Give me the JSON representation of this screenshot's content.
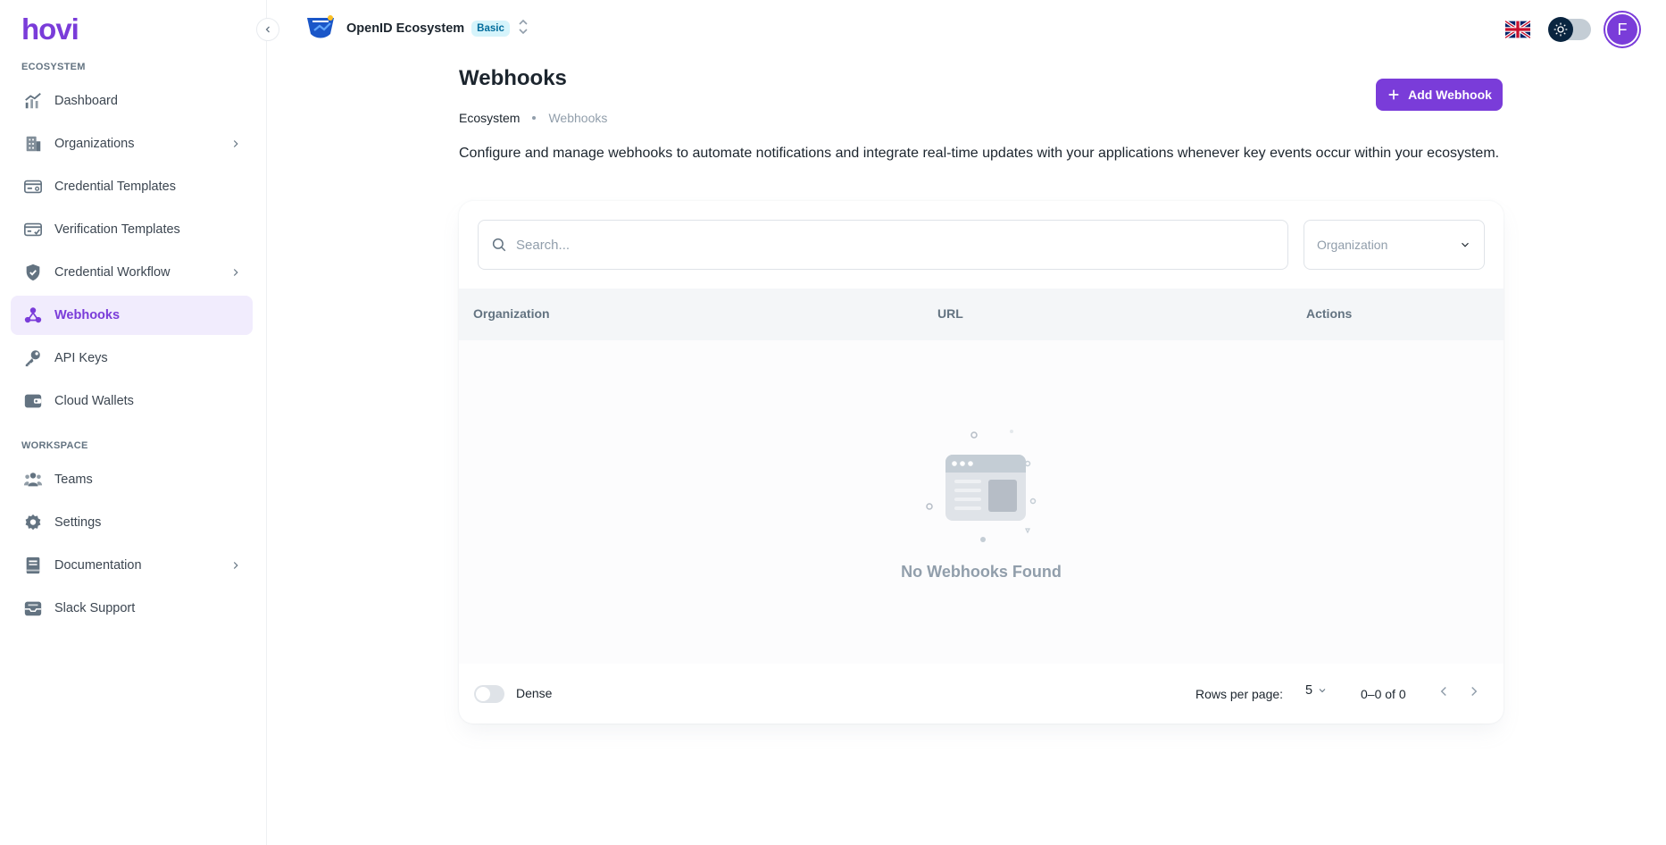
{
  "sidebar": {
    "logo": "hovi",
    "sections": [
      {
        "label": "ECOSYSTEM"
      },
      {
        "label": "WORKSPACE"
      }
    ],
    "items": [
      {
        "label": "Dashboard",
        "icon": "chart-icon"
      },
      {
        "label": "Organizations",
        "icon": "building-icon",
        "expandable": true
      },
      {
        "label": "Credential Templates",
        "icon": "card-icon"
      },
      {
        "label": "Verification Templates",
        "icon": "verify-card-icon"
      },
      {
        "label": "Credential Workflow",
        "icon": "shield-icon",
        "expandable": true
      },
      {
        "label": "Webhooks",
        "icon": "webhook-icon",
        "active": true
      },
      {
        "label": "API Keys",
        "icon": "key-icon"
      },
      {
        "label": "Cloud Wallets",
        "icon": "wallet-icon"
      },
      {
        "label": "Teams",
        "icon": "people-icon"
      },
      {
        "label": "Settings",
        "icon": "gear-icon"
      },
      {
        "label": "Documentation",
        "icon": "book-icon",
        "expandable": true
      },
      {
        "label": "Slack Support",
        "icon": "inbox-icon"
      }
    ]
  },
  "topbar": {
    "ecosystem_name": "OpenID Ecosystem",
    "plan_badge": "Basic",
    "avatar_initial": "F"
  },
  "page": {
    "title": "Webhooks",
    "breadcrumb": {
      "root": "Ecosystem",
      "current": "Webhooks"
    },
    "add_button": "Add Webhook",
    "description": "Configure and manage webhooks to automate notifications and integrate real-time updates with your applications whenever key events occur within your ecosystem."
  },
  "table": {
    "search_placeholder": "Search...",
    "org_filter_label": "Organization",
    "columns": [
      "Organization",
      "URL",
      "Actions"
    ],
    "empty_text": "No Webhooks Found",
    "dense_label": "Dense",
    "rows_per_page_label": "Rows per page:",
    "rows_per_page_value": "5",
    "range_text": "0–0 of 0"
  },
  "colors": {
    "accent": "#7a3cd9",
    "active_bg": "#f1ecfd",
    "badge_bg": "#d6f4fb",
    "badge_text": "#006c9c"
  }
}
